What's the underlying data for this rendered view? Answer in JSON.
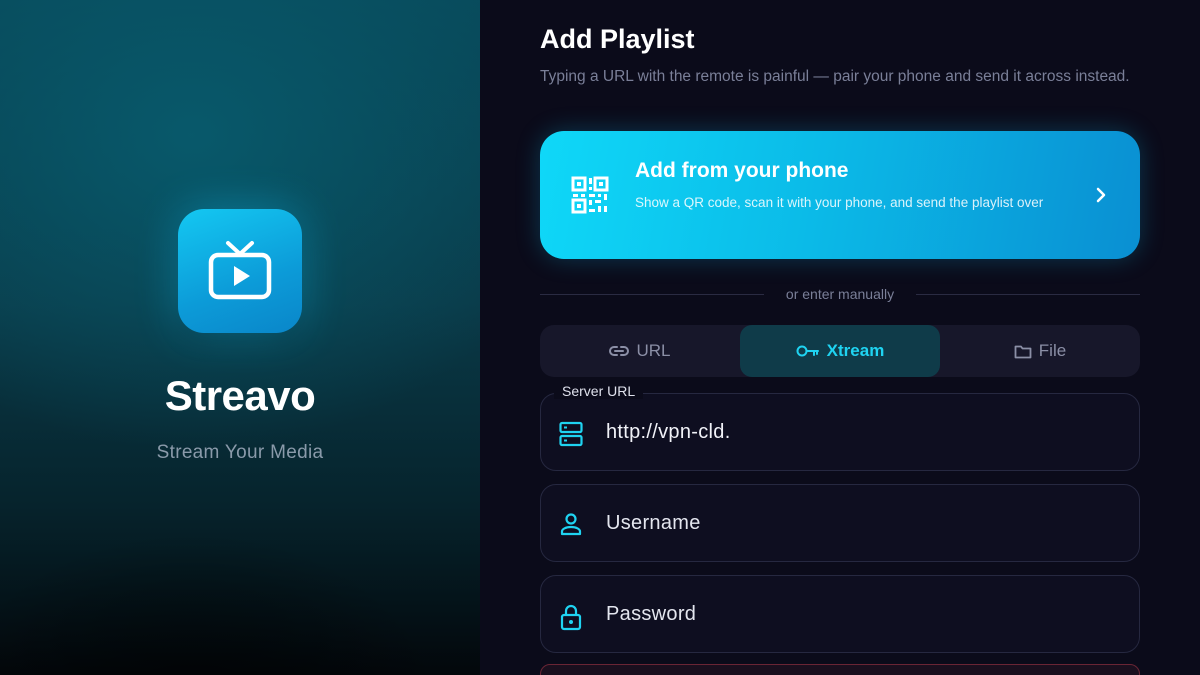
{
  "brand": {
    "name": "Streavo",
    "tagline": "Stream Your Media",
    "icon": "tv-play-icon"
  },
  "page": {
    "title": "Add Playlist",
    "subtitle": "Typing a URL with the remote is painful — pair your phone and send it across instead."
  },
  "phone_card": {
    "title": "Add from your phone",
    "description": "Show a QR code, scan it with your phone, and send the playlist over",
    "icon": "qr-code-icon",
    "action_icon": "chevron-right-icon"
  },
  "divider": {
    "text": "or enter manually"
  },
  "tabs": [
    {
      "label": "URL",
      "icon": "link-icon",
      "active": false
    },
    {
      "label": "Xtream",
      "icon": "key-icon",
      "active": true
    },
    {
      "label": "File",
      "icon": "folder-icon",
      "active": false
    }
  ],
  "form": {
    "server_url": {
      "label": "Server URL",
      "value": "http://vpn-cld.",
      "icon": "server-icon"
    },
    "username": {
      "placeholder": "Username",
      "icon": "user-icon"
    },
    "password": {
      "placeholder": "Password",
      "icon": "lock-icon"
    }
  },
  "colors": {
    "accent": "#1fd3f1",
    "background": "#0b0b1a",
    "card_gradient_start": "#0fd8f8",
    "card_gradient_end": "#0a8fd2",
    "active_tab_bg": "#0f3b49",
    "error_border": "#6a2535"
  }
}
